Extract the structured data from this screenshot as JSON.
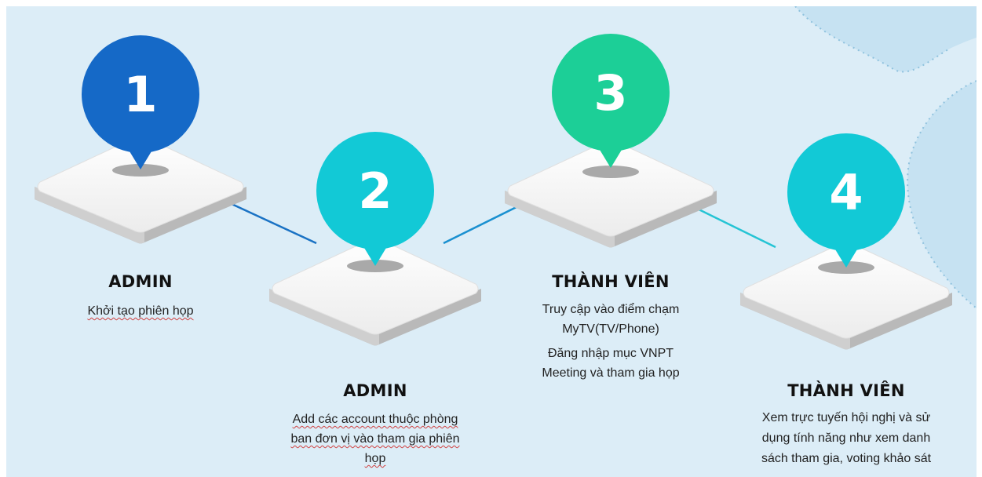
{
  "colors": {
    "background": "#dcedf7",
    "step1": "#1569c7",
    "step2": "#12c9d6",
    "step3": "#1ccf97",
    "step4": "#12c9d6",
    "connector1": "#1a72c4",
    "connector2": "#1a90d0",
    "connector3": "#25c4d4"
  },
  "steps": [
    {
      "number": "1",
      "title": "ADMIN",
      "lines": [
        "Khởi tạo phiên họp"
      ]
    },
    {
      "number": "2",
      "title": "ADMIN",
      "lines": [
        "Add các account thuộc phòng",
        "ban đơn vị vào tham gia phiên",
        "họp"
      ]
    },
    {
      "number": "3",
      "title": "THÀNH VIÊN",
      "lines": [
        "Truy cập vào điểm chạm",
        "MyTV(TV/Phone)",
        "Đăng nhập mục VNPT",
        "Meeting  và tham gia họp"
      ]
    },
    {
      "number": "4",
      "title": "THÀNH VIÊN",
      "lines": [
        "Xem trực tuyến hội nghị và sử",
        "dụng tính năng như xem danh",
        "sách tham gia, voting khảo sát"
      ]
    }
  ]
}
